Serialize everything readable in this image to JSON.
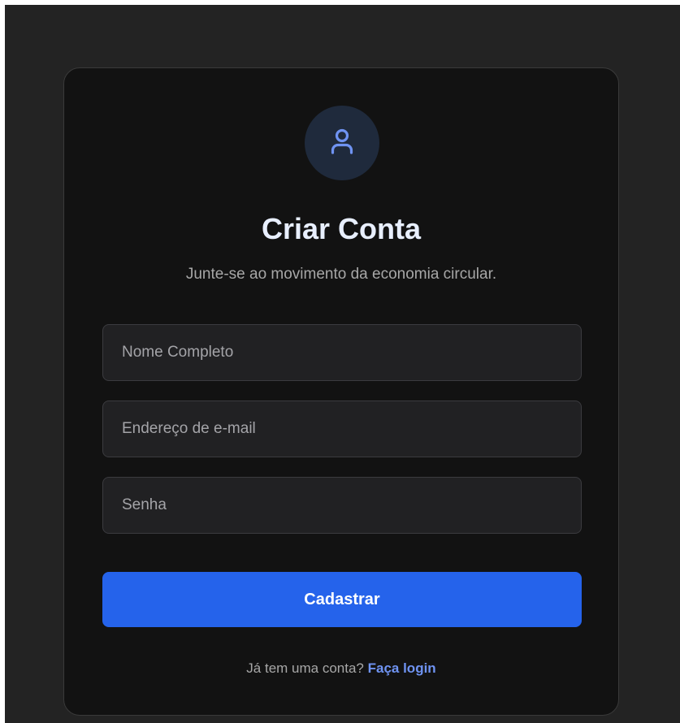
{
  "signup": {
    "title": "Criar Conta",
    "subtitle": "Junte-se ao movimento da economia circular.",
    "avatar_icon": "user-icon",
    "fields": {
      "name": {
        "placeholder": "Nome Completo",
        "value": ""
      },
      "email": {
        "placeholder": "Endereço de e-mail",
        "value": ""
      },
      "password": {
        "placeholder": "Senha",
        "value": ""
      }
    },
    "submit_label": "Cadastrar",
    "footer": {
      "prompt": "Já tem uma conta?",
      "link_label": "Faça login"
    }
  },
  "colors": {
    "page_background": "#232323",
    "card_background": "#121212",
    "accent": "#2563eb",
    "link": "#6f93f2",
    "avatar_background": "#1f2a3c",
    "avatar_icon": "#6f93f2"
  }
}
